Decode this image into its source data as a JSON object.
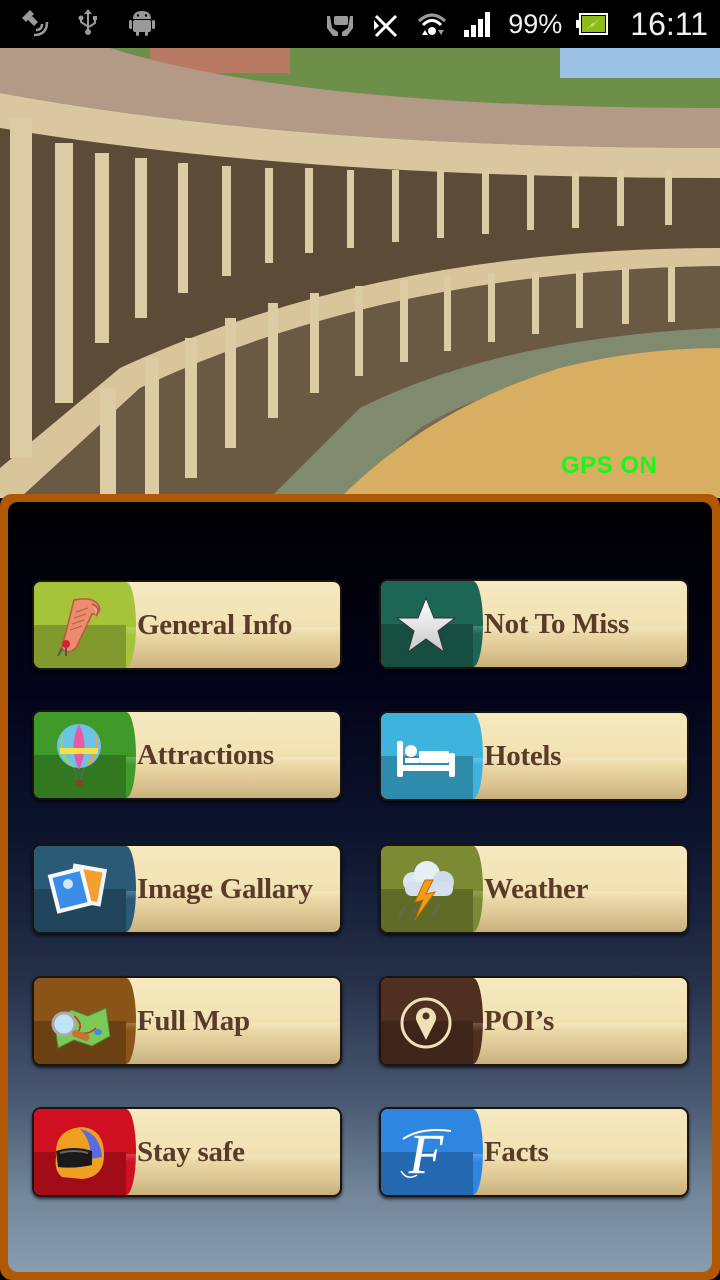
{
  "status_bar": {
    "left_icons": [
      "gps-satellite-icon",
      "usb-icon",
      "android-debug-icon"
    ],
    "right_icons": [
      "hands-icon",
      "bluetooth-off-icon",
      "wifi-icon",
      "signal-icon"
    ],
    "battery_percent": "99%",
    "battery_icon": "battery-charging-icon",
    "time": "16:11"
  },
  "hero": {
    "image_description": "bullring-arena-photo",
    "gps_status": "GPS ON",
    "gps_color": "#1cf51a"
  },
  "panel": {
    "border_color": "#b05806"
  },
  "menu": [
    {
      "id": "general-info",
      "label": "General Info",
      "icon": "scroll-icon",
      "color": "#a6c43a"
    },
    {
      "id": "not-to-miss",
      "label": "Not To Miss",
      "icon": "star-icon",
      "color": "#1d6655"
    },
    {
      "id": "attractions",
      "label": "Attractions",
      "icon": "hot-air-balloon-icon",
      "color": "#3f9a2a"
    },
    {
      "id": "hotels",
      "label": "Hotels",
      "icon": "bed-icon",
      "color": "#3db3dd"
    },
    {
      "id": "image-gallery",
      "label": "Image Gallary",
      "icon": "photos-icon",
      "color": "#2b5a76"
    },
    {
      "id": "weather",
      "label": "Weather",
      "icon": "thunderstorm-icon",
      "color": "#7c8a34"
    },
    {
      "id": "full-map",
      "label": "Full Map",
      "icon": "map-magnifier-icon",
      "color": "#8a5418"
    },
    {
      "id": "pois",
      "label": "POI’s",
      "icon": "location-pin-icon",
      "color": "#4f3020"
    },
    {
      "id": "stay-safe",
      "label": "Stay safe",
      "icon": "helmet-icon",
      "color": "#d01020"
    },
    {
      "id": "facts",
      "label": "Facts",
      "icon": "letter-f-icon",
      "color": "#2f86e0"
    }
  ]
}
